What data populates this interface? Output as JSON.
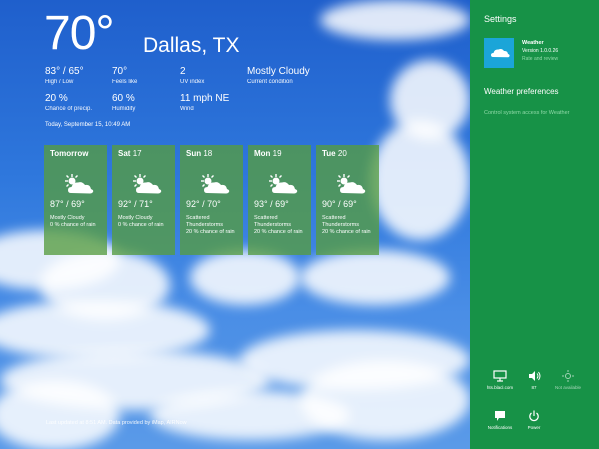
{
  "colors": {
    "accent_panel": "#179247",
    "card_bg": "#569c40",
    "link": "#8fd9a8",
    "sky": "#2f78dd"
  },
  "current": {
    "temperature": "70°",
    "city": "Dallas, TX",
    "high_low": "83° / 65°",
    "high_low_label": "High / Low",
    "feels_like": "70°",
    "feels_like_label": "Feels like",
    "uv": "2",
    "uv_label": "UV index",
    "condition": "Mostly Cloudy",
    "condition_label": "Current condition",
    "precip": "20 %",
    "precip_label": "Chance of precip.",
    "humidity": "60 %",
    "humidity_label": "Humidity",
    "wind": "11 mph NE",
    "wind_label": "Wind",
    "date": "Today, September 15, 10:49 AM"
  },
  "forecast": [
    {
      "day": "Tomorrow",
      "num": "",
      "icon": "partly-cloudy-icon",
      "hl": "87° / 69°",
      "cond": "Mostly Cloudy",
      "rain": "0 % chance of rain"
    },
    {
      "day": "Sat",
      "num": "17",
      "icon": "partly-cloudy-icon",
      "hl": "92° / 71°",
      "cond": "Mostly Cloudy",
      "rain": "0 % chance of rain"
    },
    {
      "day": "Sun",
      "num": "18",
      "icon": "partly-cloudy-icon",
      "hl": "92° / 70°",
      "cond": "Scattered Thunderstorms",
      "rain": "20 % chance of rain"
    },
    {
      "day": "Mon",
      "num": "19",
      "icon": "partly-cloudy-icon",
      "hl": "93° / 69°",
      "cond": "Scattered Thunderstorms",
      "rain": "20 % chance of rain"
    },
    {
      "day": "Tue",
      "num": "20",
      "icon": "partly-cloudy-icon",
      "hl": "90° / 69°",
      "cond": "Scattered Thunderstorms",
      "rain": "20 % chance of rain"
    }
  ],
  "footer": "Last updated at 8:51 AM. Data provided by iMap, AIRNow",
  "settings": {
    "title": "Settings",
    "app_name": "Weather",
    "app_version": "Version 1.0.0.26",
    "rate": "Rate and review",
    "preferences": "Weather preferences",
    "control_access": "Control system access for Weather"
  },
  "system": {
    "network": "hts.blacl.com",
    "network_icon": "network-icon",
    "volume": "87",
    "volume_icon": "volume-icon",
    "brightness": "Not available",
    "brightness_icon": "brightness-icon",
    "notifications": "Notifications",
    "notifications_icon": "notifications-icon",
    "power": "Power",
    "power_icon": "power-icon"
  }
}
